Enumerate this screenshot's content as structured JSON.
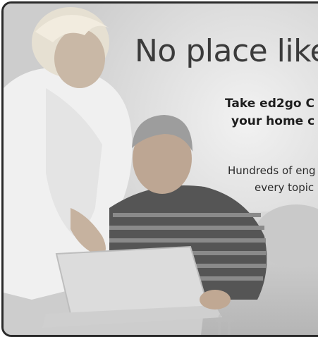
{
  "ad": {
    "headline": "No place like",
    "subheadline_line1": "Take ed2go C",
    "subheadline_line2": "your home c",
    "body_line1": "Hundreds of eng",
    "body_line2": "every topic"
  },
  "colors": {
    "frame_border": "#2a2a2a",
    "headline": "#3b3b3b",
    "text": "#1e1e1e"
  }
}
